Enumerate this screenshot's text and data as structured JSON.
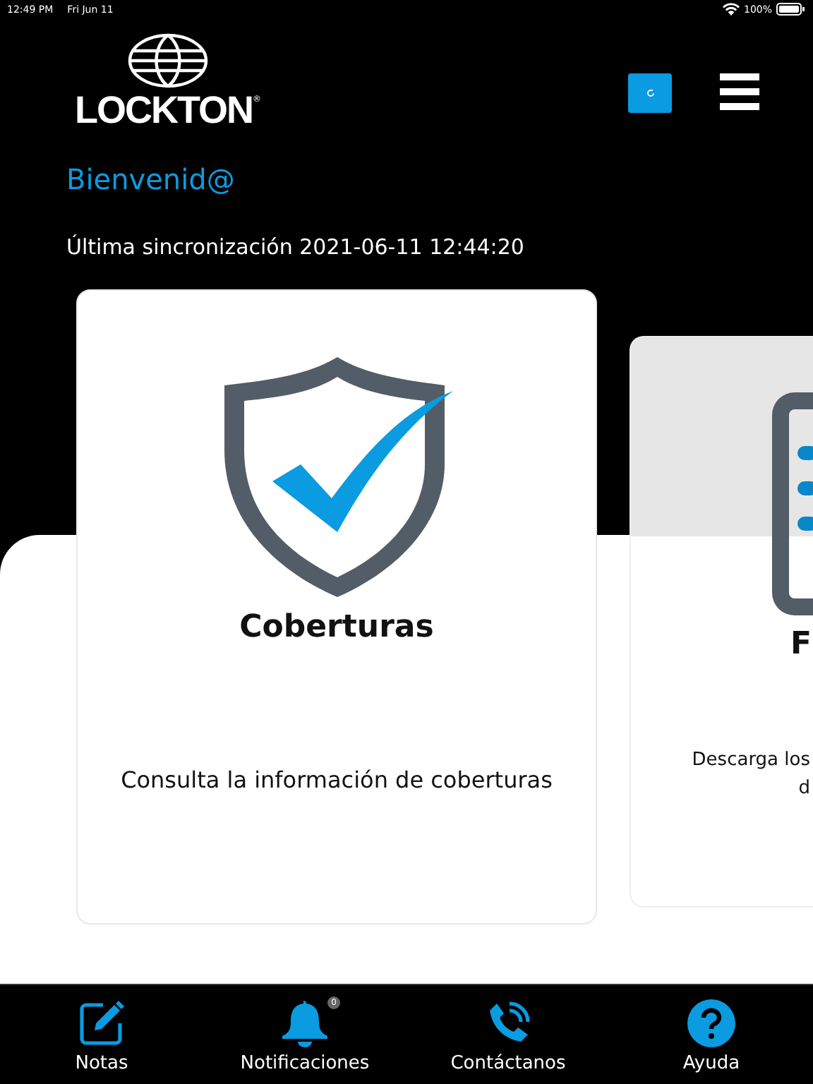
{
  "status_bar": {
    "time": "12:49 PM",
    "date": "Fri Jun 11",
    "battery": "100%"
  },
  "header": {
    "logo": "LOCKTON",
    "logo_mark": "®"
  },
  "welcome": "Bienvenid@",
  "last_sync": "Última sincronización 2021-06-11 12:44:20",
  "cards": [
    {
      "kind": "shield",
      "title": "Coberturas",
      "description": "Consulta la información de coberturas"
    },
    {
      "kind": "list",
      "title": "F",
      "description_lines": [
        "Descarga los",
        "d"
      ]
    }
  ],
  "tab_bar": [
    {
      "kind": "notes",
      "label": "Notas"
    },
    {
      "kind": "bell",
      "label": "Notificaciones",
      "badge": "0"
    },
    {
      "kind": "phone",
      "label": "Contáctanos"
    },
    {
      "kind": "help",
      "label": "Ayuda"
    }
  ]
}
